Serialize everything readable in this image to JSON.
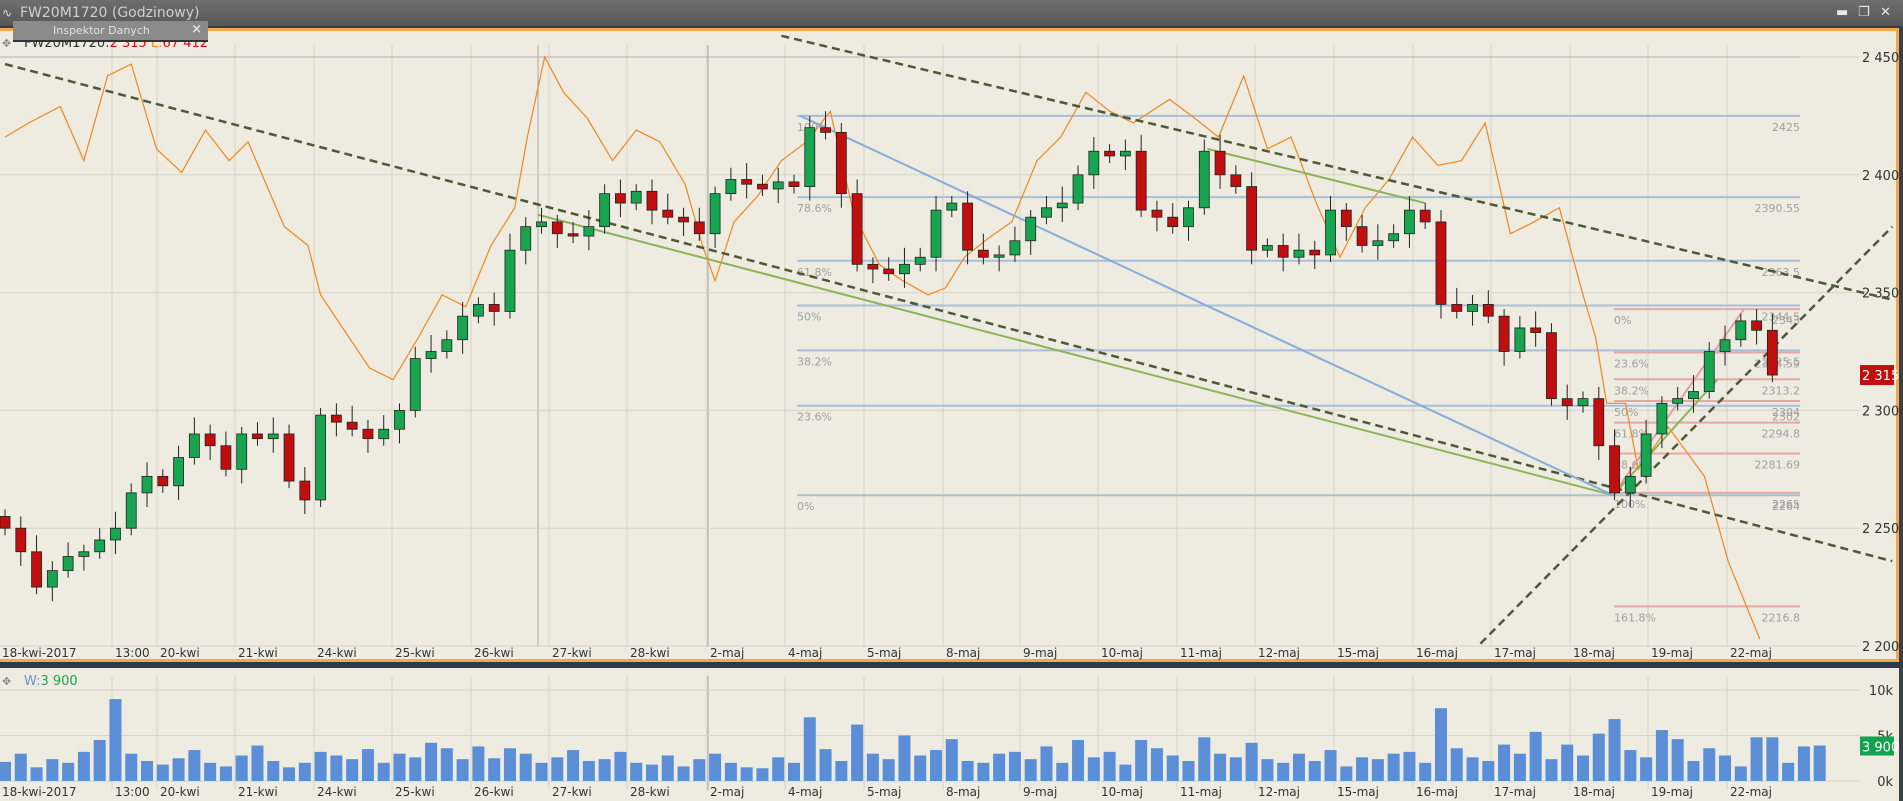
{
  "window": {
    "title": "FW20M1720 (Godzinowy)",
    "minimize_icon": "minimize-icon",
    "restore_icon": "restore-icon",
    "close_icon": "close-icon"
  },
  "inspector": {
    "title": "Inspektor Danych",
    "close": "×"
  },
  "legend": {
    "symbol": "FW20M1720:",
    "price": "2 315",
    "l_label": "L:",
    "l_value": "67 412"
  },
  "volume_legend": {
    "label": "W:",
    "value": "3 900"
  },
  "colors": {
    "up": "#18a550",
    "down": "#c10e0e",
    "overlay": "#f0881e",
    "fib_blue": "#a9bfdc",
    "fib_pink": "#e3a9a9",
    "trend_dash": "#4d5a37",
    "trend_green": "#8db45a",
    "trend_blue": "#86acdc",
    "trend_pink": "#e0a0a0",
    "current_price_bg": "#c10e0e",
    "current_volume_bg": "#13a34f"
  },
  "chart_data": [
    {
      "type": "candlestick",
      "title": "FW20M1720 (Godzinowy)",
      "price_axis": {
        "ticks": [
          "2 450",
          "2 400",
          "2 350",
          "2 300",
          "2 250",
          "2 200"
        ],
        "tick_values": [
          2450,
          2400,
          2350,
          2300,
          2250,
          2200
        ],
        "ylim": [
          2200,
          2450
        ]
      },
      "date_labels": [
        "18-kwi-2017",
        "13:00",
        "20-kwi",
        "21-kwi",
        "24-kwi",
        "25-kwi",
        "26-kwi",
        "27-kwi",
        "28-kwi",
        "2-maj",
        "4-maj",
        "5-maj",
        "8-maj",
        "9-maj",
        "10-maj",
        "11-maj",
        "12-maj",
        "15-maj",
        "16-maj",
        "17-maj",
        "18-maj",
        "19-maj",
        "22-maj"
      ],
      "closes": [
        2250,
        2240,
        2225,
        2232,
        2238,
        2240,
        2245,
        2250,
        2265,
        2272,
        2268,
        2280,
        2290,
        2285,
        2275,
        2290,
        2288,
        2290,
        2270,
        2262,
        2298,
        2295,
        2292,
        2288,
        2292,
        2300,
        2322,
        2325,
        2330,
        2340,
        2345,
        2342,
        2368,
        2378,
        2380,
        2375,
        2374,
        2378,
        2392,
        2388,
        2393,
        2385,
        2382,
        2380,
        2375,
        2392,
        2398,
        2396,
        2394,
        2397,
        2395,
        2420,
        2418,
        2392,
        2362,
        2360,
        2358,
        2362,
        2365,
        2385,
        2388,
        2368,
        2365,
        2366,
        2372,
        2382,
        2386,
        2388,
        2400,
        2410,
        2408,
        2410,
        2385,
        2382,
        2378,
        2386,
        2410,
        2400,
        2395,
        2368,
        2370,
        2365,
        2368,
        2366,
        2385,
        2378,
        2370,
        2372,
        2375,
        2385,
        2380,
        2345,
        2342,
        2345,
        2340,
        2325,
        2335,
        2333,
        2305,
        2302,
        2305,
        2285,
        2265,
        2272,
        2290,
        2303,
        2305,
        2308,
        2325,
        2330,
        2338,
        2334,
        2315
      ],
      "overlay_series": [
        [
          0,
          2416
        ],
        [
          1.5,
          2422
        ],
        [
          3.5,
          2429
        ],
        [
          5,
          2406
        ],
        [
          6.5,
          2442
        ],
        [
          8,
          2447
        ],
        [
          9.6,
          2411
        ],
        [
          11.2,
          2401
        ],
        [
          12.7,
          2419
        ],
        [
          14.2,
          2406
        ],
        [
          15.4,
          2414
        ],
        [
          17.7,
          2378
        ],
        [
          19.2,
          2370
        ],
        [
          20,
          2349
        ],
        [
          21.5,
          2334
        ],
        [
          23.1,
          2318
        ],
        [
          24.6,
          2313
        ],
        [
          26.2,
          2331
        ],
        [
          27.7,
          2349
        ],
        [
          29.2,
          2344
        ],
        [
          30.8,
          2370
        ],
        [
          32.3,
          2386
        ],
        [
          33.1,
          2416
        ],
        [
          34.2,
          2450
        ],
        [
          35.4,
          2435
        ],
        [
          36.9,
          2424
        ],
        [
          38.5,
          2406
        ],
        [
          40,
          2419
        ],
        [
          41.5,
          2414
        ],
        [
          43.1,
          2396
        ],
        [
          44.2,
          2370
        ],
        [
          45,
          2355
        ],
        [
          46.2,
          2380
        ],
        [
          47.7,
          2391
        ],
        [
          49.2,
          2406
        ],
        [
          50.8,
          2414
        ],
        [
          52.3,
          2427
        ],
        [
          53.8,
          2383
        ],
        [
          55.4,
          2362
        ],
        [
          56.9,
          2355
        ],
        [
          58.5,
          2349
        ],
        [
          59.6,
          2352
        ],
        [
          60.8,
          2365
        ],
        [
          62.3,
          2373
        ],
        [
          63.8,
          2380
        ],
        [
          65.4,
          2406
        ],
        [
          66.9,
          2416
        ],
        [
          68.5,
          2435
        ],
        [
          70,
          2427
        ],
        [
          71.5,
          2422
        ],
        [
          73.8,
          2432
        ],
        [
          75.4,
          2424
        ],
        [
          76.9,
          2416
        ],
        [
          78.5,
          2442
        ],
        [
          80,
          2411
        ],
        [
          81.5,
          2416
        ],
        [
          83.1,
          2388
        ],
        [
          84.6,
          2365
        ],
        [
          86.2,
          2386
        ],
        [
          87.7,
          2398
        ],
        [
          89.2,
          2416
        ],
        [
          90.8,
          2404
        ],
        [
          92.3,
          2406
        ],
        [
          93.8,
          2422
        ],
        [
          95.4,
          2375
        ],
        [
          96.9,
          2380
        ],
        [
          98.5,
          2386
        ],
        [
          100,
          2349
        ],
        [
          100.8,
          2331
        ],
        [
          101.5,
          2303
        ],
        [
          102.7,
          2303
        ],
        [
          103.5,
          2275
        ],
        [
          105.4,
          2293
        ],
        [
          107.7,
          2272
        ],
        [
          109.2,
          2236
        ],
        [
          111.2,
          2203
        ]
      ],
      "fib_blue": {
        "levels": [
          "100%",
          "78.6%",
          "61.8%",
          "50%",
          "38.2%",
          "23.6%",
          "0%"
        ],
        "values": [
          2425,
          2390.55,
          2363.5,
          2344.5,
          2325.5,
          2302,
          2264
        ],
        "value_labels": [
          "2425",
          "2390.55",
          "2363.5",
          "2344.5",
          "2325.5",
          "2302",
          "2264"
        ]
      },
      "fib_pink": {
        "levels": [
          "0%",
          "23.6%",
          "38.2%",
          "50%",
          "61.8%",
          "78.6%",
          "100%",
          "161.8%"
        ],
        "values": [
          2343,
          2324.59,
          2313.2,
          2304,
          2294.8,
          2281.69,
          2265,
          2216.8
        ],
        "value_labels": [
          "2343",
          "2324.59",
          "2313.2",
          "2304",
          "2294.8",
          "2281.69",
          "2265",
          "2216.8"
        ]
      },
      "trendlines": [
        {
          "name": "dashed-trendline-lower",
          "style": "dash",
          "points": [
            [
              0,
              2447
            ],
            [
              119.6,
              2236
            ]
          ]
        },
        {
          "name": "dashed-trendline-upper",
          "style": "dash",
          "points": [
            [
              49.2,
              2459
            ],
            [
              119.6,
              2347
            ]
          ]
        },
        {
          "name": "dashed-trendline-rising",
          "style": "dash",
          "points": [
            [
              93.5,
              2201
            ],
            [
              119.6,
              2378
            ]
          ]
        },
        {
          "name": "green-trendline",
          "style": "green",
          "points": [
            [
              33.8,
              2383
            ],
            [
              101.9,
              2264
            ]
          ]
        },
        {
          "name": "green-trendline-upper",
          "style": "green",
          "points": [
            [
              76.2,
              2411
            ],
            [
              90,
              2388
            ]
          ]
        },
        {
          "name": "blue-trendline",
          "style": "blue",
          "points": [
            [
              50.4,
              2425
            ],
            [
              101.9,
              2264
            ]
          ]
        },
        {
          "name": "pink-trendline",
          "style": "pink",
          "points": [
            [
              101.9,
              2264
            ],
            [
              110.2,
              2343
            ]
          ]
        },
        {
          "name": "lightgreen-trendline",
          "style": "green",
          "points": [
            [
              101.9,
              2264
            ],
            [
              108.5,
              2313
            ]
          ]
        }
      ],
      "current_price": "2 315",
      "current_price_value": 2315
    },
    {
      "type": "bar",
      "title": "W",
      "volume_axis": {
        "ticks": [
          "10k",
          "5k",
          "0k"
        ],
        "tick_values": [
          10,
          5,
          0
        ]
      },
      "values_k": [
        2.1,
        3.0,
        1.5,
        2.4,
        2.0,
        3.2,
        4.5,
        9.0,
        3.0,
        2.2,
        1.8,
        2.5,
        3.4,
        2.0,
        1.6,
        2.8,
        3.9,
        2.2,
        1.5,
        2.0,
        3.2,
        2.8,
        2.4,
        3.5,
        2.0,
        3.0,
        2.6,
        4.2,
        3.6,
        2.4,
        3.8,
        2.5,
        3.6,
        3.0,
        2.0,
        2.6,
        3.4,
        2.2,
        2.4,
        3.2,
        2.0,
        1.8,
        2.8,
        1.6,
        2.4,
        3.0,
        2.0,
        1.5,
        1.4,
        2.6,
        2.0,
        7.0,
        3.5,
        2.2,
        6.2,
        3.0,
        2.4,
        5.0,
        2.8,
        3.4,
        4.6,
        2.2,
        2.0,
        3.0,
        3.2,
        2.4,
        3.8,
        2.0,
        4.5,
        2.6,
        3.2,
        1.8,
        4.5,
        3.6,
        2.8,
        2.2,
        4.8,
        3.0,
        2.6,
        4.2,
        2.4,
        2.0,
        3.0,
        2.2,
        3.4,
        1.6,
        2.6,
        2.4,
        3.0,
        3.2,
        2.0,
        8.0,
        3.6,
        2.6,
        2.2,
        4.0,
        3.0,
        5.4,
        2.4,
        4.0,
        2.8,
        5.2,
        6.8,
        3.4,
        2.6,
        5.6,
        4.6,
        2.2,
        3.6,
        2.8,
        1.6,
        4.8,
        4.8,
        2.0,
        3.8,
        3.9
      ],
      "current_value": "3 900"
    }
  ]
}
